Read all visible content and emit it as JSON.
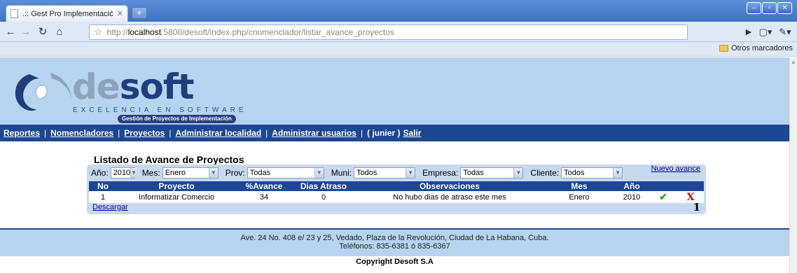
{
  "browser": {
    "tab_title": ".:: Gest Pro Implementació...",
    "url_prefix": "http://",
    "url_host": "localhost",
    "url_rest": ":5800/desoft/index.php/cnomenclador/listar_avance_proyectos",
    "bookmark_folder": "Otros marcadores"
  },
  "banner": {
    "logo_de": "de",
    "logo_soft": "soft",
    "tagline": "EXCELENCIA  EN  SOFTWARE",
    "pill": "Gestión de Proyectos de Implementación"
  },
  "menu": {
    "items": [
      "Reportes",
      "Nomencladores",
      "Proyectos",
      "Administrar localidad",
      "Administrar usuarios"
    ],
    "user": "( junier )",
    "logout": "Salir"
  },
  "list": {
    "title": "Listado de Avance de Proyectos",
    "filters": {
      "anio_label": "Año:",
      "anio_value": "2010",
      "mes_label": "Mes:",
      "mes_value": "Enero",
      "prov_label": "Prov:",
      "prov_value": "Todas",
      "muni_label": "Muni:",
      "muni_value": "Todos",
      "empresa_label": "Empresa:",
      "empresa_value": "Todas",
      "cliente_label": "Cliente:",
      "cliente_value": "Todos"
    },
    "nuevo_avance": "Nuevo avance",
    "columns": [
      "No",
      "Proyecto",
      "%Avance",
      "Dias Atraso",
      "Observaciones",
      "Mes",
      "Año"
    ],
    "rows": [
      [
        "1",
        "Informatizar Comercio",
        "34",
        "0",
        "No hubo dias de atraso este mes",
        "Enero",
        "2010"
      ]
    ],
    "descargar": "Descargar",
    "page": "1"
  },
  "footer": {
    "address": "Ave. 24 No. 408 e/ 23 y 25, Vedado, Plaza de la Revolución, Ciudad de La Habana, Cuba.",
    "phones": "Teléfonos: 835-6381 ó 835-6367",
    "copyright": "Copyright Desoft S.A"
  },
  "colors": {
    "menu_blue": "#1c4792",
    "banner_blue": "#b6d4ef",
    "list_bg": "#c6d9ef"
  }
}
